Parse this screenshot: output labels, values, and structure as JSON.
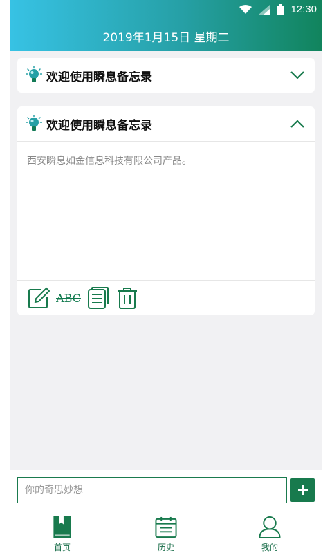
{
  "status_bar": {
    "time": "12:30"
  },
  "header": {
    "date": "2019年1月15日 星期二"
  },
  "memos": [
    {
      "title": "欢迎使用瞬息备忘录",
      "expanded": false
    },
    {
      "title": "欢迎使用瞬息备忘录",
      "expanded": true,
      "content": "西安瞬息如金信息科技有限公司产品。"
    }
  ],
  "toolbar": {
    "abc_label": "ABC",
    "icons": [
      "edit-icon",
      "strikethrough-icon",
      "notes-icon",
      "trash-icon"
    ]
  },
  "input": {
    "placeholder": "你的奇思妙想"
  },
  "nav": [
    {
      "label": "首页",
      "icon": "bookmark-book-icon"
    },
    {
      "label": "历史",
      "icon": "calendar-icon"
    },
    {
      "label": "我的",
      "icon": "user-icon"
    }
  ],
  "colors": {
    "accent": "#187a4d",
    "header_start": "#37c2e4",
    "header_end": "#11845d",
    "background": "#f1f1f3"
  }
}
